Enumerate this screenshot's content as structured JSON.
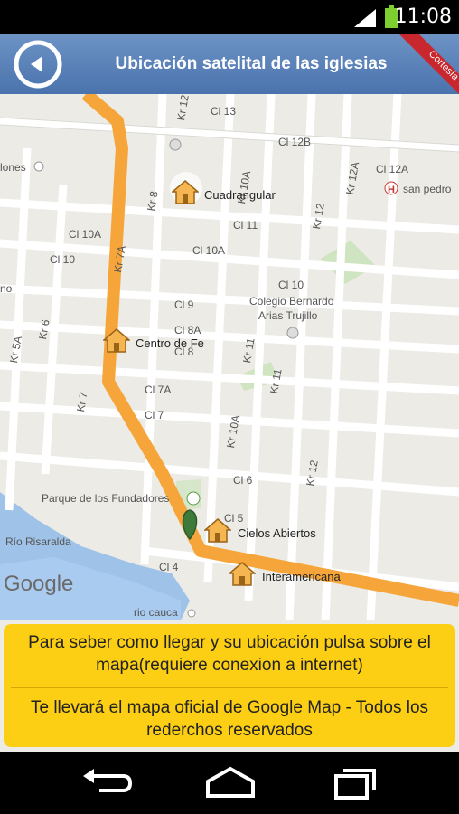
{
  "status_bar": {
    "time": "11:08"
  },
  "header": {
    "title": "Ubicación satelital de las iglesias"
  },
  "ribbon": {
    "text": "Cortesía VIP EDUCACIONES"
  },
  "map": {
    "streets": [
      "Cl 13",
      "Cl 12B",
      "Cl 12A",
      "Cl 11",
      "Cl 10A",
      "Cl 10A",
      "Cl 10",
      "Cl 10",
      "Cl 9",
      "Cl 8A",
      "Cl 8",
      "Cl 7A",
      "Cl 7",
      "Cl 6",
      "Cl 5",
      "Cl 4",
      "Kr 12",
      "Kr 10A",
      "Kr 12A",
      "Kr 12",
      "Kr 11",
      "Kr 11",
      "Kr 10A",
      "Kr 12",
      "Kr 8",
      "Kr 7A",
      "Kr 7",
      "Kr 6",
      "Kr 5A",
      "lones",
      "no",
      "Parque de los Fundadores",
      "Río Risaralda",
      "rio cauca",
      "Colegio Bernardo",
      "Arias Trujillo",
      "san pedro"
    ],
    "churches": [
      "Cuadrangular",
      "Centro de Fe",
      "Cielos Abiertos",
      "Interamericana"
    ],
    "watermark": "Google"
  },
  "info": {
    "line1": "Para seber como llegar y su ubicación pulsa sobre el mapa(requiere conexion a internet)",
    "line2": "Te llevará el mapa oficial de Google Map - Todos los rederchos reservados"
  }
}
